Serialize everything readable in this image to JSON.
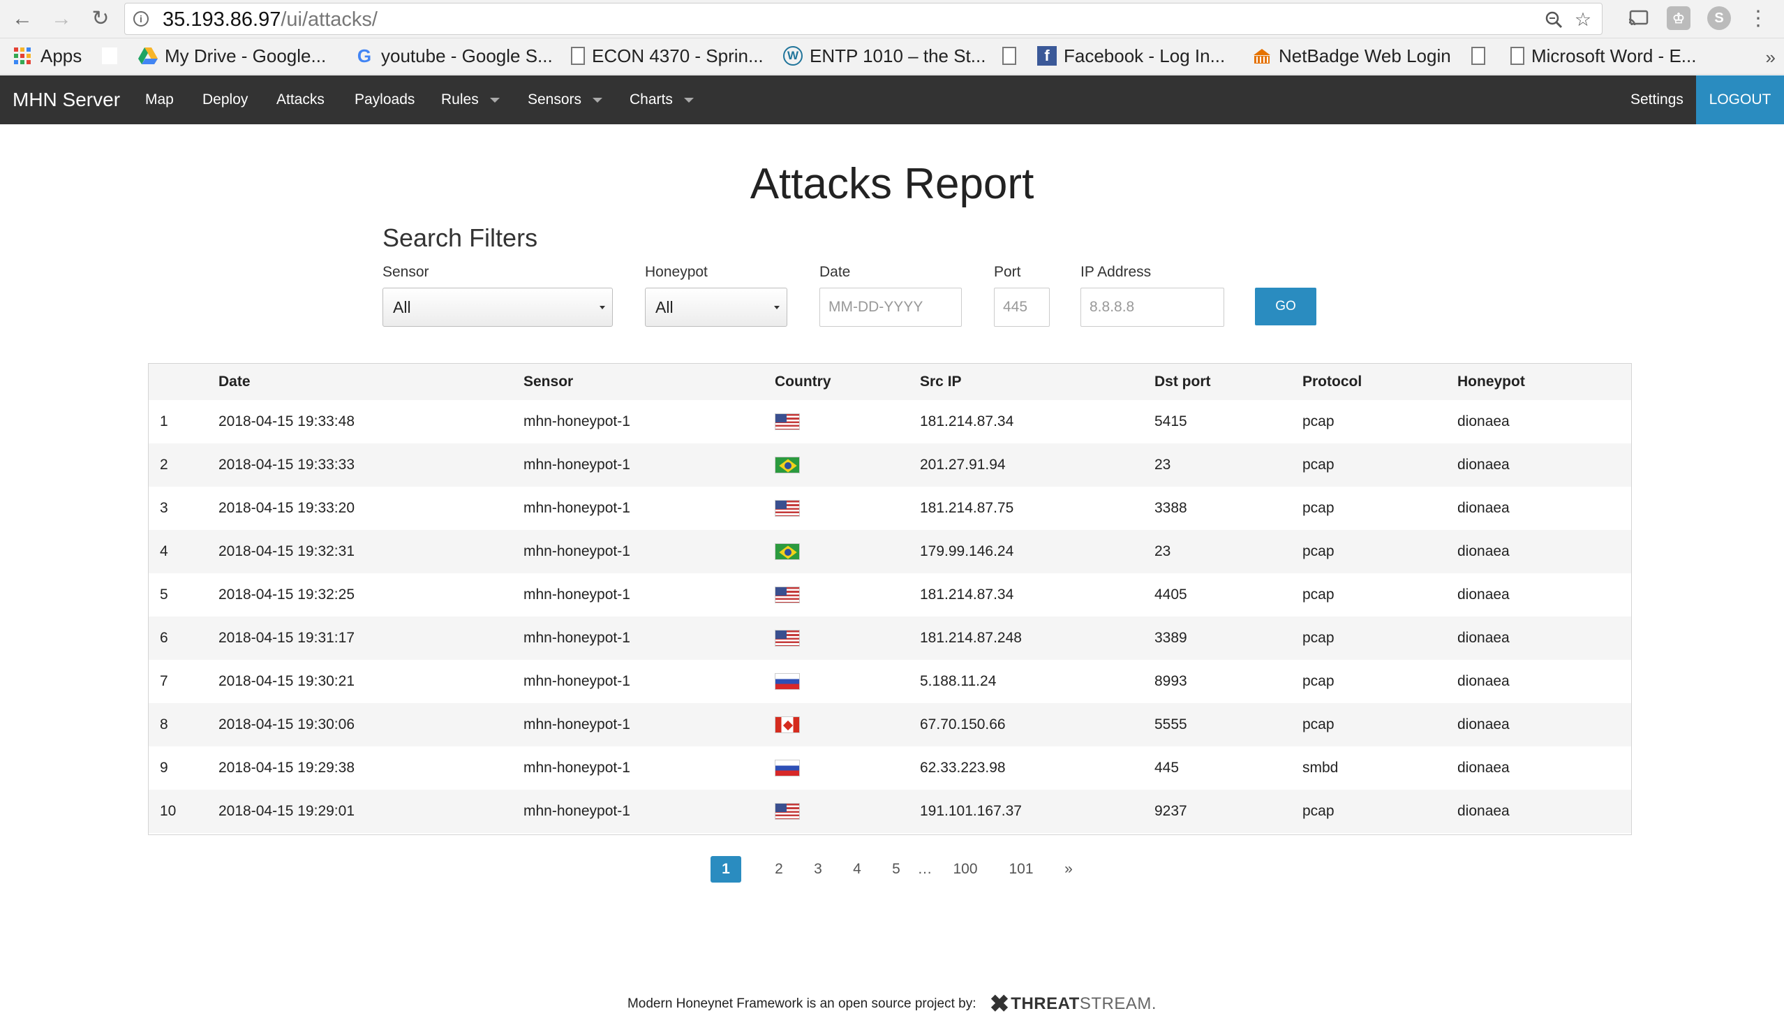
{
  "browser": {
    "url_host": "35.193.86.97",
    "url_path": "/ui/attacks/",
    "bookmarks": [
      {
        "label": "Apps"
      },
      {
        "label": "My Drive - Google..."
      },
      {
        "label": "youtube - Google S..."
      },
      {
        "label": "ECON 4370 - Sprin..."
      },
      {
        "label": "ENTP 1010 – the St..."
      },
      {
        "label": "Facebook - Log In..."
      },
      {
        "label": "NetBadge Web Login"
      },
      {
        "label": "Microsoft Word - E..."
      }
    ]
  },
  "navbar": {
    "brand": "MHN Server",
    "items": [
      "Map",
      "Deploy",
      "Attacks",
      "Payloads",
      "Rules",
      "Sensors",
      "Charts"
    ],
    "settings": "Settings",
    "logout": "LOGOUT"
  },
  "page": {
    "title": "Attacks Report",
    "filters_title": "Search Filters"
  },
  "filters": {
    "sensor_label": "Sensor",
    "sensor_value": "All",
    "honeypot_label": "Honeypot",
    "honeypot_value": "All",
    "date_label": "Date",
    "date_placeholder": "MM-DD-YYYY",
    "port_label": "Port",
    "port_placeholder": "445",
    "ip_label": "IP Address",
    "ip_placeholder": "8.8.8.8",
    "go": "GO"
  },
  "table": {
    "headers": [
      "",
      "Date",
      "Sensor",
      "Country",
      "Src IP",
      "Dst port",
      "Protocol",
      "Honeypot"
    ],
    "rows": [
      {
        "num": "1",
        "date": "2018-04-15 19:33:48",
        "sensor": "mhn-honeypot-1",
        "country": "us",
        "src_ip": "181.214.87.34",
        "dst_port": "5415",
        "protocol": "pcap",
        "honeypot": "dionaea"
      },
      {
        "num": "2",
        "date": "2018-04-15 19:33:33",
        "sensor": "mhn-honeypot-1",
        "country": "br",
        "src_ip": "201.27.91.94",
        "dst_port": "23",
        "protocol": "pcap",
        "honeypot": "dionaea"
      },
      {
        "num": "3",
        "date": "2018-04-15 19:33:20",
        "sensor": "mhn-honeypot-1",
        "country": "us",
        "src_ip": "181.214.87.75",
        "dst_port": "3388",
        "protocol": "pcap",
        "honeypot": "dionaea"
      },
      {
        "num": "4",
        "date": "2018-04-15 19:32:31",
        "sensor": "mhn-honeypot-1",
        "country": "br",
        "src_ip": "179.99.146.24",
        "dst_port": "23",
        "protocol": "pcap",
        "honeypot": "dionaea"
      },
      {
        "num": "5",
        "date": "2018-04-15 19:32:25",
        "sensor": "mhn-honeypot-1",
        "country": "us",
        "src_ip": "181.214.87.34",
        "dst_port": "4405",
        "protocol": "pcap",
        "honeypot": "dionaea"
      },
      {
        "num": "6",
        "date": "2018-04-15 19:31:17",
        "sensor": "mhn-honeypot-1",
        "country": "us",
        "src_ip": "181.214.87.248",
        "dst_port": "3389",
        "protocol": "pcap",
        "honeypot": "dionaea"
      },
      {
        "num": "7",
        "date": "2018-04-15 19:30:21",
        "sensor": "mhn-honeypot-1",
        "country": "ru",
        "src_ip": "5.188.11.24",
        "dst_port": "8993",
        "protocol": "pcap",
        "honeypot": "dionaea"
      },
      {
        "num": "8",
        "date": "2018-04-15 19:30:06",
        "sensor": "mhn-honeypot-1",
        "country": "ca",
        "src_ip": "67.70.150.66",
        "dst_port": "5555",
        "protocol": "pcap",
        "honeypot": "dionaea"
      },
      {
        "num": "9",
        "date": "2018-04-15 19:29:38",
        "sensor": "mhn-honeypot-1",
        "country": "ru",
        "src_ip": "62.33.223.98",
        "dst_port": "445",
        "protocol": "smbd",
        "honeypot": "dionaea"
      },
      {
        "num": "10",
        "date": "2018-04-15 19:29:01",
        "sensor": "mhn-honeypot-1",
        "country": "us",
        "src_ip": "191.101.167.37",
        "dst_port": "9237",
        "protocol": "pcap",
        "honeypot": "dionaea"
      }
    ]
  },
  "pagination": {
    "pages": [
      "1",
      "2",
      "3",
      "4",
      "5",
      "…",
      "100",
      "101",
      "»"
    ],
    "active": "1"
  },
  "footer": {
    "text": "Modern Honeynet Framework is an open source project by:",
    "logo_threat": "THREAT",
    "logo_stream": "STREAM."
  },
  "colors": {
    "navbar_bg": "#333333",
    "accent": "#2a8cc0"
  }
}
